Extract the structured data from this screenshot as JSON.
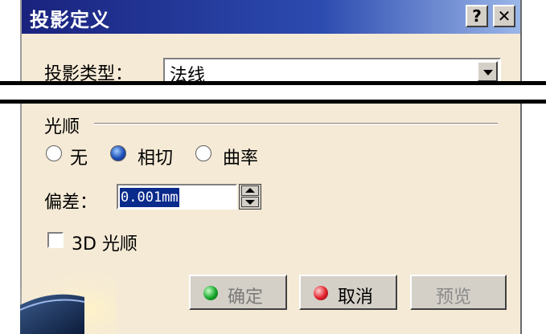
{
  "window": {
    "title": "投影定义",
    "help_label": "?",
    "close_label": "✕"
  },
  "projection": {
    "label": "投影类型：",
    "value": "法线"
  },
  "smoothing": {
    "group_label": "光顺",
    "options": [
      {
        "label": "无",
        "selected": false
      },
      {
        "label": "相切",
        "selected": true
      },
      {
        "label": "曲率",
        "selected": false
      }
    ]
  },
  "deviation": {
    "label": "偏差：",
    "value": "0.001mm"
  },
  "smooth3d": {
    "label": "3D 光顺",
    "checked": false
  },
  "buttons": {
    "ok": "确定",
    "cancel": "取消",
    "preview": "预览"
  },
  "colors": {
    "title_bar": "#1a237e",
    "dialog_bg": "#f5ead6",
    "selection": "#0a2a8c"
  }
}
